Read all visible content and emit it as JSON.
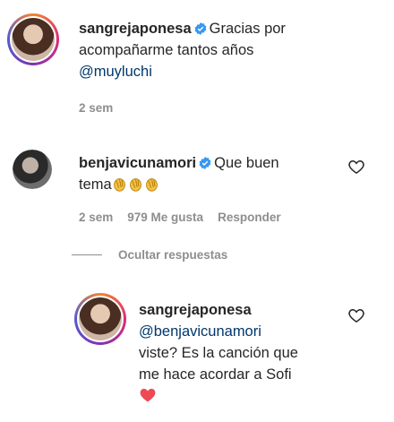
{
  "comment1": {
    "username": "sangrejaponesa",
    "verified": true,
    "text_line1": "Gracias por",
    "text_line2": "acompañarme tantos años",
    "mention": "@muyluchi",
    "time": "2 sem"
  },
  "comment2": {
    "username": "benjavicunamori",
    "verified": true,
    "text_line1": "Que buen",
    "text_line2": "tema",
    "emoji": [
      "clapping-hands",
      "clapping-hands",
      "clapping-hands"
    ],
    "time": "2 sem",
    "likes": "979 Me gusta",
    "reply_label": "Responder"
  },
  "replies_toggle": {
    "label": "Ocultar respuestas"
  },
  "reply1": {
    "username": "sangrejaponesa",
    "mention": "@benjavicunamori",
    "text_line1": "viste? Es la canción que",
    "text_line2": "me hace acordar a Sofi",
    "emoji": "red-heart"
  },
  "colors": {
    "text": "#262626",
    "meta": "#8e8e8e",
    "mention": "#00376b",
    "verified": "#3897f0",
    "heart": "#ed4956"
  }
}
